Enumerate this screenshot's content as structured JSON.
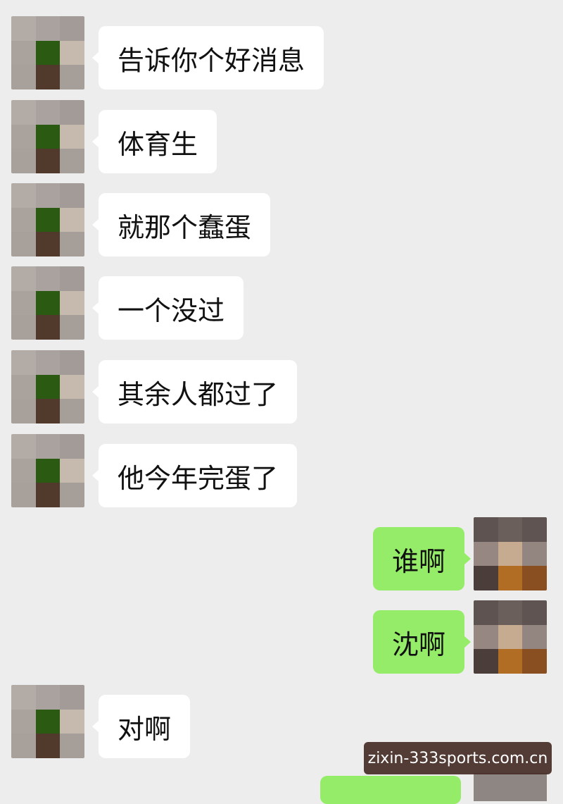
{
  "messages": [
    {
      "side": "in",
      "text": "告诉你个好消息"
    },
    {
      "side": "in",
      "text": "体育生"
    },
    {
      "side": "in",
      "text": "就那个蠢蛋"
    },
    {
      "side": "in",
      "text": "一个没过"
    },
    {
      "side": "in",
      "text": "其余人都过了"
    },
    {
      "side": "in",
      "text": "他今年完蛋了"
    },
    {
      "side": "out",
      "text": "谁啊"
    },
    {
      "side": "out",
      "text": "沈啊"
    },
    {
      "side": "in",
      "text": "对啊"
    }
  ],
  "watermark": "zixin-333sports.com.cn",
  "colors": {
    "background": "#ededed",
    "incoming_bubble": "#ffffff",
    "outgoing_bubble": "#95ec69",
    "avatar_in": [
      "#b3aba6",
      "#aaa29e",
      "#a39b97",
      "#aaa29c",
      "#2b5a12",
      "#c6b9ae",
      "#a8a09b",
      "#513a2c",
      "#a69e99"
    ],
    "avatar_out": [
      "#5e5350",
      "#6a5f5b",
      "#5f5452",
      "#968783",
      "#c7ab90",
      "#938580",
      "#4b3d3a",
      "#b26d25",
      "#8a4f20"
    ]
  }
}
